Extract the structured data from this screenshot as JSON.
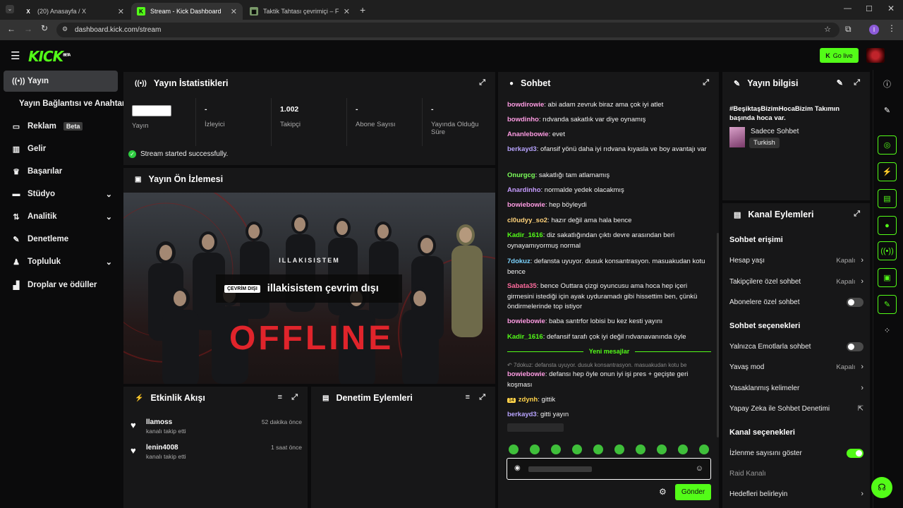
{
  "browser": {
    "tabs": [
      {
        "title": "(20) Anasayfa / X"
      },
      {
        "title": "Stream - Kick Dashboard"
      },
      {
        "title": "Taktik Tahtası çevrimiçi – Futbol"
      }
    ],
    "url": "dashboard.kick.com/stream",
    "profile_initial": "I"
  },
  "brand": {
    "logo": "KICK",
    "logo_sup": "BETA",
    "go_live": "Go live"
  },
  "sidebar": {
    "items": [
      {
        "label": "Yayın",
        "icon": "broadcast-icon"
      },
      {
        "label": "Yayın Bağlantısı ve Anahtarı",
        "icon": ""
      },
      {
        "label": "Reklam",
        "icon": "ad-icon",
        "badge": "Beta"
      },
      {
        "label": "Gelir",
        "icon": "chart-icon"
      },
      {
        "label": "Başarılar",
        "icon": "trophy-icon"
      },
      {
        "label": "Stüdyo",
        "icon": "studio-icon"
      },
      {
        "label": "Analitik",
        "icon": "analytics-icon"
      },
      {
        "label": "Denetleme",
        "icon": "wrench-icon"
      },
      {
        "label": "Topluluk",
        "icon": "community-icon"
      },
      {
        "label": "Droplar ve ödüller",
        "icon": "gift-icon"
      }
    ]
  },
  "stats": {
    "title": "Yayın İstatistikleri",
    "items": [
      {
        "value": "",
        "label": "Yayın"
      },
      {
        "value": "-",
        "label": "İzleyici"
      },
      {
        "value": "1.002",
        "label": "Takipçi"
      },
      {
        "value": "-",
        "label": "Abone Sayısı"
      },
      {
        "value": "-",
        "label": "Yayında Olduğu Süre"
      }
    ],
    "status": "Stream started successfully."
  },
  "preview": {
    "title": "Yayın Ön İzlemesi",
    "channel_watermark": "ILLAKISISTEM",
    "offline_badge": "ÇEVRİM DIŞI",
    "offline_text": "illakisistem çevrim dışı"
  },
  "activity": {
    "title": "Etkinlik Akışı",
    "events": [
      {
        "name": "llamoss",
        "desc": "kanalı takip etti",
        "time": "52 dakika önce"
      },
      {
        "name": "lenin4008",
        "desc": "kanalı takip etti",
        "time": "1 saat önce"
      }
    ]
  },
  "moderation": {
    "title": "Denetim Eylemleri"
  },
  "chat": {
    "title": "Sohbet",
    "messages": [
      {
        "user": "bowdirowie",
        "text": "abi adam zevruk biraz ama çok iyi atlet",
        "color": "#ff9ce3"
      },
      {
        "user": "bowdinho",
        "text": "rıdvanda sakatlık var diye oynamış",
        "color": "#ff9ce3"
      },
      {
        "user": "Ananlebowie",
        "text": "evet",
        "color": "#ff9ce3"
      },
      {
        "user": "berkayd3",
        "text": "ofansif yönü daha iyi rıdvana kıyasla ve boy avantajı var",
        "color": "#b8a4ff"
      },
      {
        "user": "Onurgcg",
        "text": "sakatlığı tam atlamamış",
        "color": "#7cff5a"
      },
      {
        "user": "Anardinho",
        "text": "normalde yedek olacakmış",
        "color": "#c69cff"
      },
      {
        "user": "bowiebowie",
        "text": "hep böyleydi",
        "color": "#ff9ce3"
      },
      {
        "user": "cl0udyy_so2",
        "text": "hazır değil ama hala bence",
        "color": "#ffd27a"
      },
      {
        "user": "Kadir_1616",
        "text": "diz sakatlığından çıktı devre arasından beri oynayamıyormuş normal",
        "color": "#53fc18"
      },
      {
        "user": "7dokuz",
        "text": "defansta uyuyor. dusuk konsantrasyon. masuakudan kotu bence",
        "color": "#7cd4ff"
      },
      {
        "user": "Sabata35",
        "text": "bence Outtara çizgi oyuncusu ama hoca hep içeri girmesini istediği için ayak uyduramadı gibi hissettim ben, çünkü öndirmelerinde top istiyor",
        "color": "#ff6b9d"
      },
      {
        "user": "bowiebowie",
        "text": "baba santrfor lobisi bu kez kesti yayını",
        "color": "#ff9ce3"
      },
      {
        "user": "Kadir_1616",
        "text": "defansif tarafı çok iyi değil rıdvanavanında öyle",
        "color": "#53fc18"
      }
    ],
    "new_messages": "Yeni mesajlar",
    "reply_preview": "7dokuz: defansta uyuyor. dusuk konsantrasyon. masuakudan kotu be",
    "after": [
      {
        "user": "bowiebowie",
        "text": "defansı hep öyle onun iyi işi pres + geçişte geri koşması",
        "color": "#ff9ce3"
      },
      {
        "user": "zdynh",
        "text": "gittik",
        "color": "#ffd24a",
        "badge": "14"
      },
      {
        "user": "berkayd3",
        "text": "gitti yayın",
        "color": "#b8a4ff"
      }
    ],
    "send_label": "Gönder"
  },
  "stream_info": {
    "title": "Yayın bilgisi",
    "stream_title": "#BeşiktaşBizimHocaBizim Takımın başında hoca var.",
    "category": "Sadece Sohbet",
    "language": "Turkish"
  },
  "channel_actions": {
    "title": "Kanal Eylemleri",
    "chat_access": "Sohbet erişimi",
    "account_age": {
      "label": "Hesap yaşı",
      "value": "Kapalı"
    },
    "followers_only": {
      "label": "Takipçilere özel sohbet",
      "value": "Kapalı"
    },
    "subs_only": {
      "label": "Abonelere özel sohbet",
      "on": false
    },
    "chat_options": "Sohbet seçenekleri",
    "emote_only": {
      "label": "Yalnızca Emotlarla sohbet",
      "on": false
    },
    "slow_mode": {
      "label": "Yavaş mod",
      "value": "Kapalı"
    },
    "banned_words": {
      "label": "Yasaklanmış kelimeler"
    },
    "ai_moderation": {
      "label": "Yapay Zeka ile Sohbet Denetimi"
    },
    "channel_options": "Kanal seçenekleri",
    "show_views": {
      "label": "İzlenme sayısını göster",
      "on": true
    },
    "raid": {
      "label": "Raid Kanalı"
    },
    "goals": {
      "label": "Hedefleri belirleyin"
    }
  },
  "colors": {
    "accent": "#53fc18",
    "panel": "#171718",
    "bg": "#0b0b0c",
    "offline_red": "#e0242b"
  }
}
